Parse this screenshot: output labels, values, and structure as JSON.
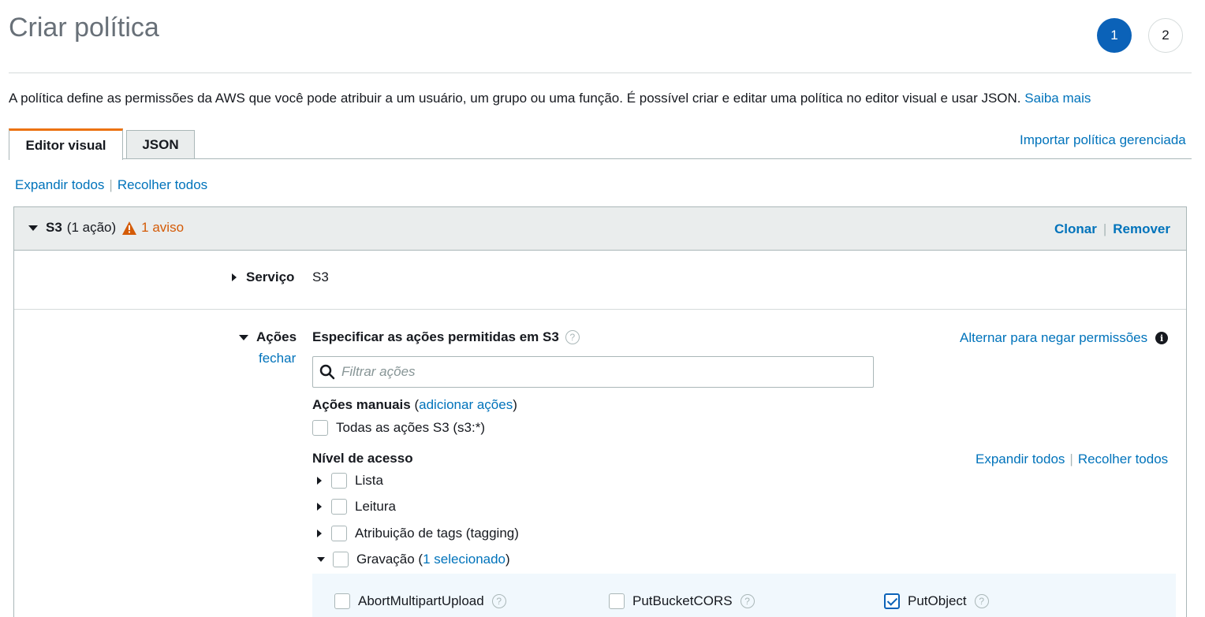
{
  "page": {
    "title": "Criar política",
    "steps": [
      "1",
      "2"
    ],
    "description": "A política define as permissões da AWS que você pode atribuir a um usuário, um grupo ou uma função. É possível criar e editar uma política no editor visual e usar JSON.",
    "learn_more": "Saiba mais"
  },
  "tabs": {
    "visual": "Editor visual",
    "json": "JSON",
    "import": "Importar política gerenciada"
  },
  "toolbar": {
    "expand_all": "Expandir todos",
    "collapse_all": "Recolher todos"
  },
  "panel": {
    "service_short": "S3",
    "action_count": "(1 ação)",
    "warning": "1 aviso",
    "clone": "Clonar",
    "remove": "Remover",
    "service_label": "Serviço",
    "service_value": "S3",
    "actions_label": "Ações",
    "actions_close": "fechar",
    "specify_title": "Especificar as ações permitidas em S3",
    "toggle_deny": "Alternar para negar permissões",
    "filter_placeholder": "Filtrar ações",
    "manual_title": "Ações manuais",
    "manual_open": "(",
    "manual_add": "adicionar ações",
    "manual_close": ")",
    "all_actions": "Todas as ações S3 (s3:*)",
    "access_level": "Nível de acesso",
    "level_expand": "Expandir todos",
    "level_collapse": "Recolher todos",
    "levels": {
      "list": "Lista",
      "read": "Leitura",
      "tagging": "Atribuição de tags (tagging)",
      "write": "Gravação (",
      "write_selected": "1 selecionado",
      "write_end": ")"
    },
    "write_actions": {
      "abort": "AbortMultipartUpload",
      "cors": "PutBucketCORS",
      "put": "PutObject"
    }
  },
  "colors": {
    "accent": "#0b62b8",
    "link": "#0073bb",
    "warning": "#d45b07",
    "tab_active": "#ec7211"
  }
}
